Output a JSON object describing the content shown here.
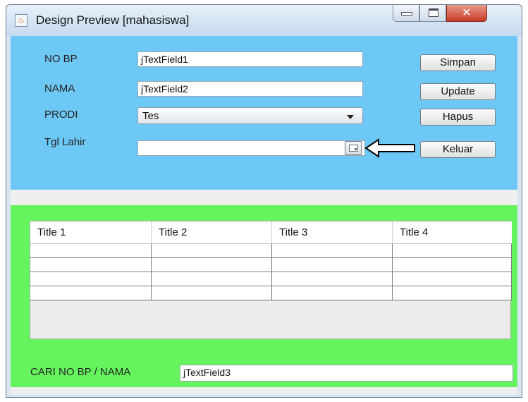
{
  "window": {
    "title": "Design Preview [mahasiswa]",
    "controls": [
      "minimize-icon",
      "maximize-icon",
      "close-icon"
    ]
  },
  "form": {
    "nobp_label": "NO BP",
    "nobp_value": "jTextField1",
    "nama_label": "NAMA",
    "nama_value": "jTextField2",
    "prodi_label": "PRODI",
    "prodi_value": "Tes",
    "tgl_label": "Tgl Lahir",
    "tgl_value": ""
  },
  "buttons": {
    "simpan": "Simpan",
    "update": "Update",
    "hapus": "Hapus",
    "keluar": "Keluar"
  },
  "table": {
    "columns": [
      "Title 1",
      "Title 2",
      "Title 3",
      "Title 4"
    ],
    "rows": [
      [
        "",
        "",
        "",
        ""
      ],
      [
        "",
        "",
        "",
        ""
      ],
      [
        "",
        "",
        "",
        ""
      ],
      [
        "",
        "",
        "",
        ""
      ]
    ]
  },
  "search": {
    "label": "CARI NO BP / NAMA",
    "value": "jTextField3"
  },
  "colors": {
    "form_panel": "#6ec8f6",
    "table_panel": "#66f45e"
  }
}
